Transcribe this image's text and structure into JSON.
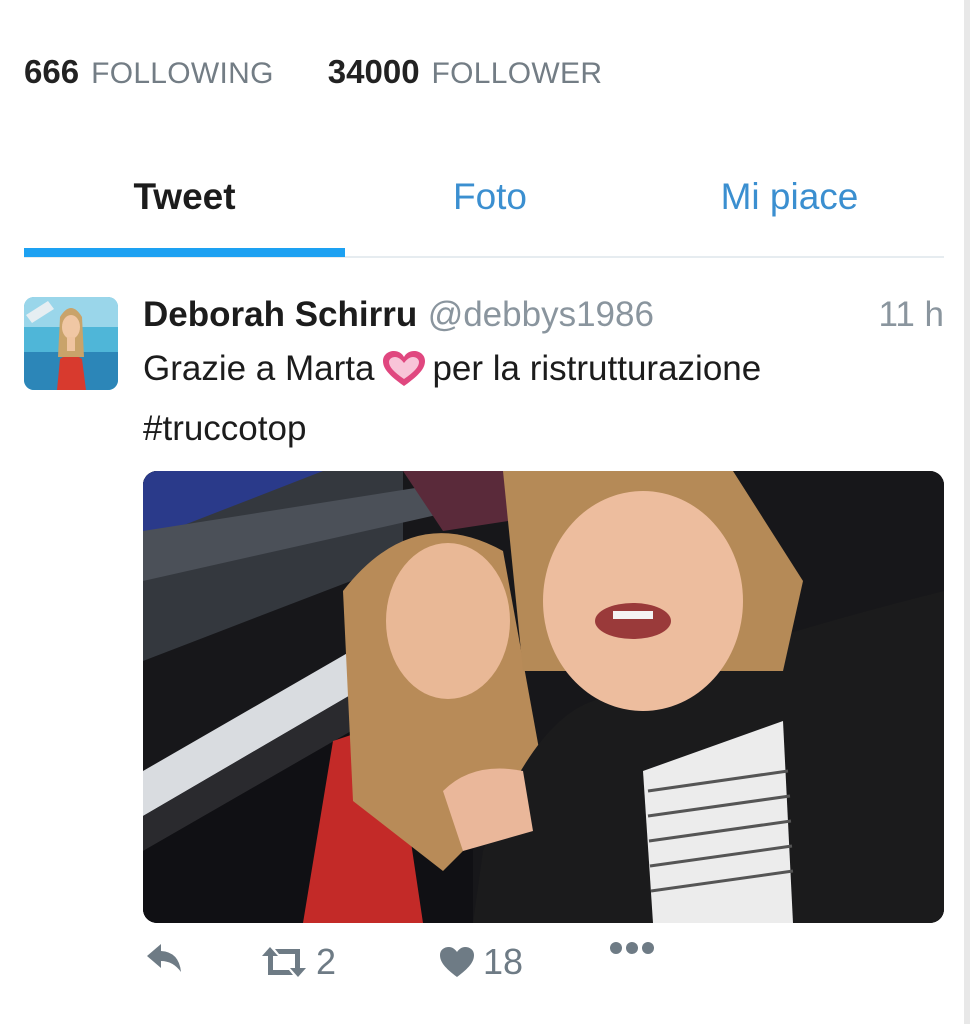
{
  "stats": {
    "following_count": "666",
    "following_label": "FOLLOWING",
    "follower_count": "34000",
    "follower_label": "FOLLOWER"
  },
  "tabs": [
    {
      "label": "Tweet",
      "active": true
    },
    {
      "label": "Foto",
      "active": false
    },
    {
      "label": "Mi piace",
      "active": false
    }
  ],
  "tweet": {
    "author_name": "Deborah Schirru",
    "handle": "@debbys1986",
    "time": "11 h",
    "text_before_emoji": "Grazie a Marta",
    "emoji": "pink-heart-emoji",
    "text_after_emoji": "per la ristrutturazione",
    "hashtag": "#truccotop",
    "retweet_count": "2",
    "like_count": "18"
  },
  "colors": {
    "accent": "#1da1f2",
    "tab_inactive": "#3b8fd0",
    "muted": "#737d85",
    "text": "#1c1c1c",
    "heart_emoji": "#e0477f"
  }
}
